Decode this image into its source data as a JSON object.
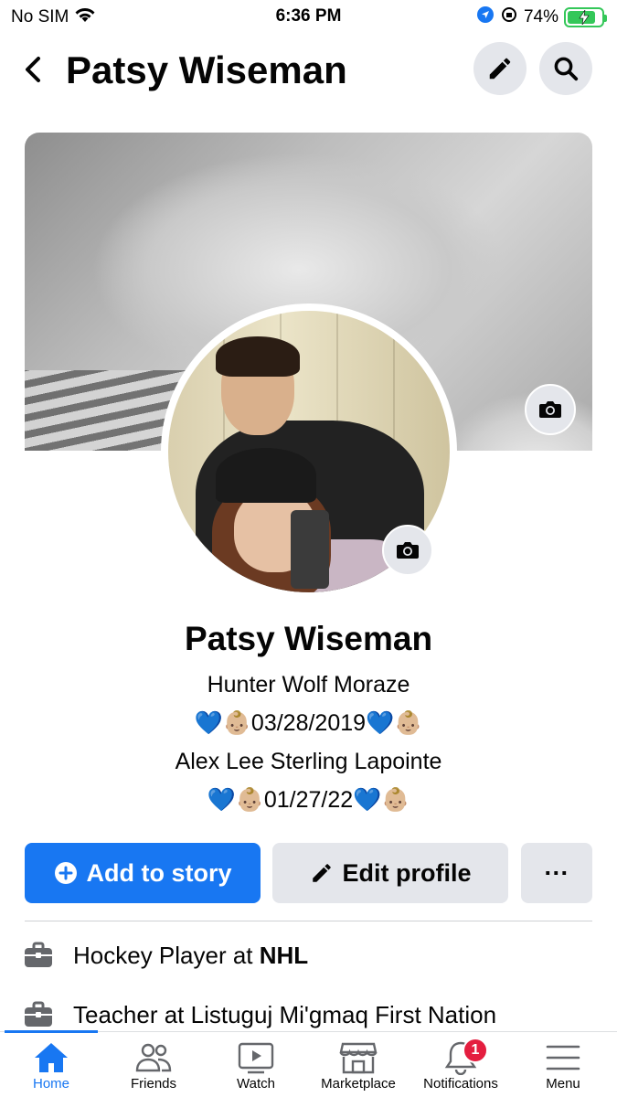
{
  "status_bar": {
    "carrier": "No SIM",
    "time": "6:36 PM",
    "battery": "74%",
    "battery_level": 0.74
  },
  "header": {
    "title": "Patsy Wiseman",
    "back_icon": "chevron-left-icon",
    "edit_icon": "pencil-icon",
    "search_icon": "search-icon"
  },
  "profile": {
    "name": "Patsy Wiseman",
    "bio_lines": [
      "Hunter Wolf Moraze",
      "💙👶🏼03/28/2019💙👶🏼",
      "Alex Lee Sterling Lapointe",
      "💙👶🏼01/27/22💙👶🏼"
    ]
  },
  "actions": {
    "add_to_story": "Add to story",
    "edit_profile": "Edit profile",
    "more": "···"
  },
  "work": [
    {
      "prefix": "Hockey Player at ",
      "place": "NHL"
    },
    {
      "prefix": "Teacher at Listuguj Mi'gmaq First Nation",
      "place": ""
    }
  ],
  "tabs": [
    {
      "label": "Home",
      "icon": "home-icon"
    },
    {
      "label": "Friends",
      "icon": "friends-icon"
    },
    {
      "label": "Watch",
      "icon": "watch-icon"
    },
    {
      "label": "Marketplace",
      "icon": "marketplace-icon"
    },
    {
      "label": "Notifications",
      "icon": "bell-icon",
      "badge": "1"
    },
    {
      "label": "Menu",
      "icon": "menu-icon"
    }
  ],
  "colors": {
    "accent": "#1877f2",
    "button_gray": "#e4e6eb",
    "badge_red": "#e41e3f",
    "battery_green": "#34c759"
  }
}
